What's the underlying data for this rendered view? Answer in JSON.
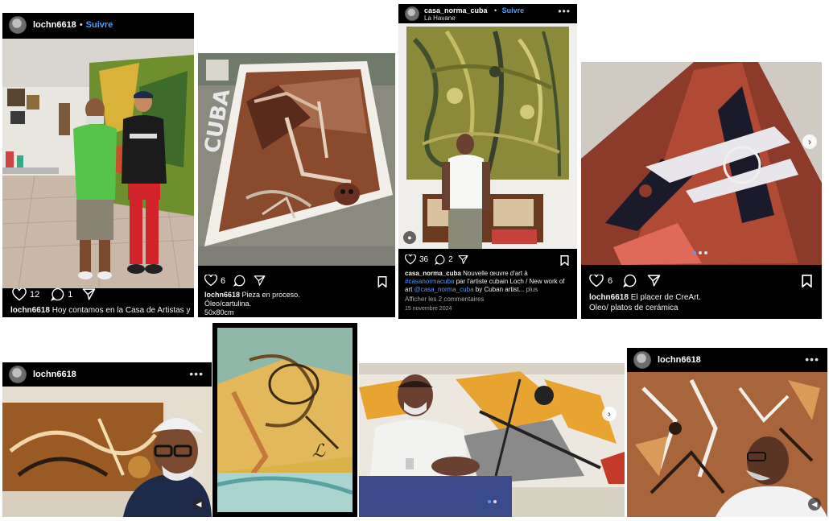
{
  "follow_label": "Suivre",
  "post1": {
    "username": "lochn6618",
    "likes": "12",
    "comments": "1",
    "caption_user": "lochn6618",
    "caption_text": "Hoy contamos en la Casa de Artistas y"
  },
  "post2": {
    "likes": "6",
    "caption_user": "lochn6618",
    "caption_line1": "Pieza en proceso.",
    "caption_line2": "Óleo/cartulina.",
    "caption_line3": "50x80cm",
    "wall_text": "CUBA"
  },
  "post3": {
    "username": "casa_norma_cuba",
    "location": "La Havane",
    "likes": "36",
    "comments": "2",
    "caption_user": "casa_norma_cuba",
    "caption_line1": "Nouvelle œuvre d'art à",
    "caption_hashtag": "#casanormacuba",
    "caption_line2": "par l'artiste cubain Loch / New work of",
    "caption_line3a": "art",
    "caption_mention": "@casa_norma_cuba",
    "caption_line3b": "by Cuban artist...",
    "caption_more": "plus",
    "show_comments": "Afficher les 2 commentaires",
    "date": "15 novembre 2024"
  },
  "post4": {
    "likes": "6",
    "caption_user": "lochn6618",
    "caption_line1": "El placer de CreArt.",
    "caption_line2": "Oleo/ platos de cerámica"
  },
  "post5": {
    "username": "lochn6618"
  },
  "post8": {
    "username": "lochn6618"
  },
  "icons": {
    "heart": "heart-icon",
    "comment": "comment-icon",
    "share": "share-icon",
    "bookmark": "bookmark-icon",
    "more": "more-icon",
    "next": "chevron-right-icon",
    "sound": "sound-icon"
  },
  "colors": {
    "background": "#ffffff",
    "tile": "#000000",
    "link": "#4a9eff",
    "text": "#ffffff",
    "muted": "#a9a9a9"
  }
}
